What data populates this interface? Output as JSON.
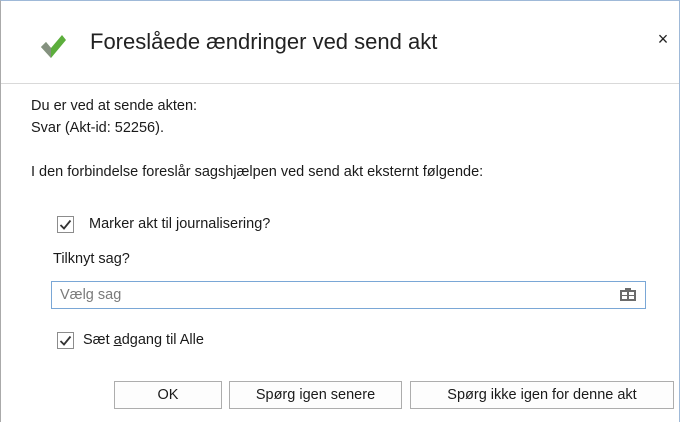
{
  "dialog": {
    "title": "Foreslåede ændringer ved send akt",
    "close_label": "×",
    "intro_line1": "Du er ved at sende akten:",
    "intro_line2": "Svar (Akt-id: 52256).",
    "suggestion_text": "I den forbindelse foreslår sagshjælpen ved send akt eksternt følgende:",
    "journal_checkbox": {
      "label": "Marker akt til journalisering?",
      "checked": true
    },
    "case_label": "Tilknyt sag?",
    "case_input": {
      "value": "",
      "placeholder": "Vælg sag"
    },
    "access_checkbox": {
      "label_pre": "Sæt ",
      "label_underlined": "a",
      "label_post": "dgang til Alle",
      "checked": true
    },
    "buttons": {
      "ok": "OK",
      "ask_later": "Spørg igen senere",
      "dont_ask": "Spørg ikke igen for denne akt"
    }
  },
  "icons": {
    "title": "green-check-icon",
    "lookup": "lookup-icon",
    "close": "close-icon"
  },
  "colors": {
    "check_green": "#5cae3c",
    "check_gray": "#8c8c8c",
    "input_border": "#7aa7d6"
  }
}
